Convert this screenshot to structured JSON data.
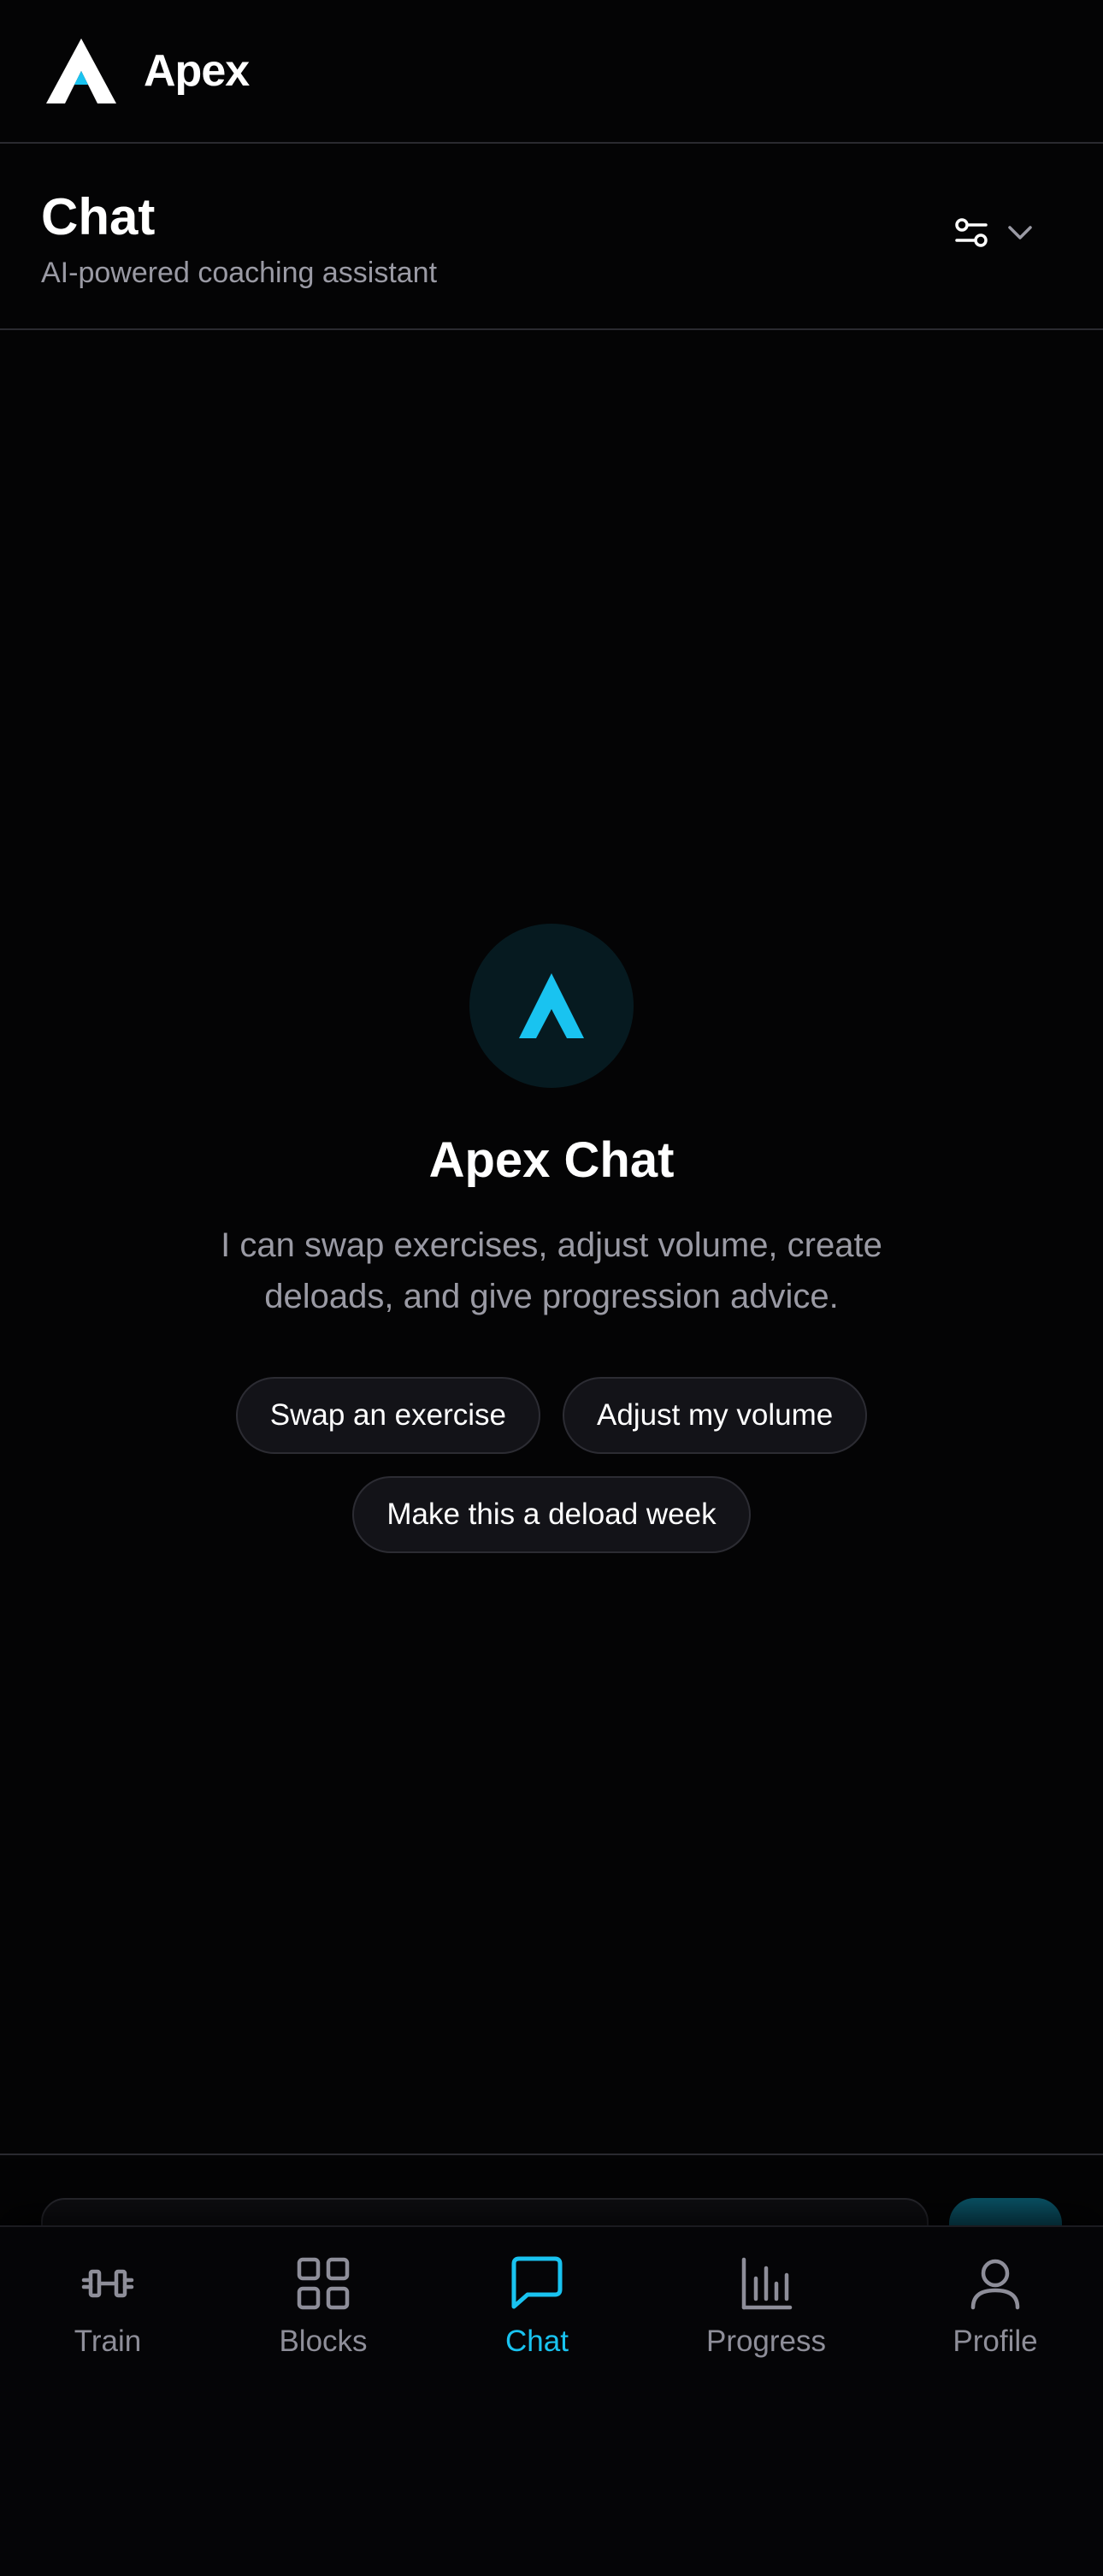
{
  "app": {
    "name": "Apex",
    "logo_icon": "apex-logo-icon"
  },
  "header": {
    "title": "Chat",
    "subtitle": "AI-powered coaching assistant",
    "filter_icon": "sliders-icon",
    "dropdown_icon": "chevron-down-icon"
  },
  "empty_state": {
    "title": "Apex Chat",
    "description": "I can swap exercises, adjust volume, create deloads, and give progression advice.",
    "suggestions": [
      "Swap an exercise",
      "Adjust my volume",
      "Make this a deload week"
    ]
  },
  "tabs": [
    {
      "label": "Train",
      "icon": "dumbbell-icon",
      "active": false
    },
    {
      "label": "Blocks",
      "icon": "grid-icon",
      "active": false
    },
    {
      "label": "Chat",
      "icon": "chat-bubble-icon",
      "active": true
    },
    {
      "label": "Progress",
      "icon": "bar-chart-icon",
      "active": false
    },
    {
      "label": "Profile",
      "icon": "user-icon",
      "active": false
    }
  ],
  "colors": {
    "background": "#040405",
    "accent": "#19c3f0",
    "muted_text": "#9a9aa4",
    "chip_bg": "#131318"
  }
}
